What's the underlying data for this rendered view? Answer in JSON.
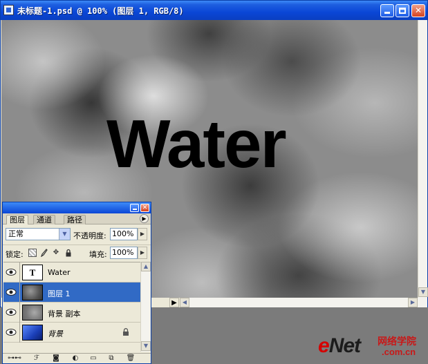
{
  "document": {
    "title": "未标题-1.psd @ 100% (图层 1, RGB/8)",
    "canvas_text": "Water"
  },
  "layers_panel": {
    "tabs": [
      "图层",
      "通道",
      "路径"
    ],
    "blend_mode": "正常",
    "opacity_label": "不透明度:",
    "opacity_value": "100%",
    "lock_label": "锁定:",
    "fill_label": "填充:",
    "fill_value": "100%",
    "layers": [
      {
        "name": "Water",
        "thumb_label": "T"
      },
      {
        "name": "图层 1"
      },
      {
        "name": "背景 副本"
      },
      {
        "name": "背景"
      }
    ],
    "selected_layer": "图层 1"
  },
  "watermark": {
    "brand_e": "e",
    "brand_rest": "Net",
    "cn": "网络学院",
    "domain": ".com.cn"
  },
  "colors": {
    "titlebar": "#0a46d6",
    "selection": "#316ac5",
    "close_button": "#d4431f"
  }
}
